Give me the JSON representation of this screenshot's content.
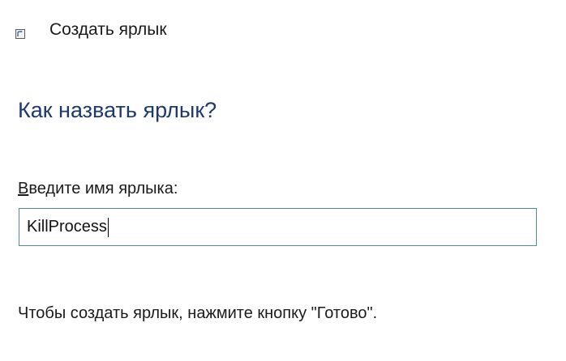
{
  "window": {
    "icon": "shortcut-icon",
    "title": "Создать ярлык"
  },
  "main": {
    "heading": "Как назвать ярлык?",
    "name_field": {
      "label_access_key": "В",
      "label_rest": "ведите имя ярлыка:",
      "value": "KillProcess"
    },
    "hint": "Чтобы создать ярлык, нажмите кнопку \"Готово\"."
  },
  "colors": {
    "heading": "#1d3a6e",
    "input_border": "#4b8e97",
    "text": "#1a1a1a",
    "background": "#ffffff"
  }
}
